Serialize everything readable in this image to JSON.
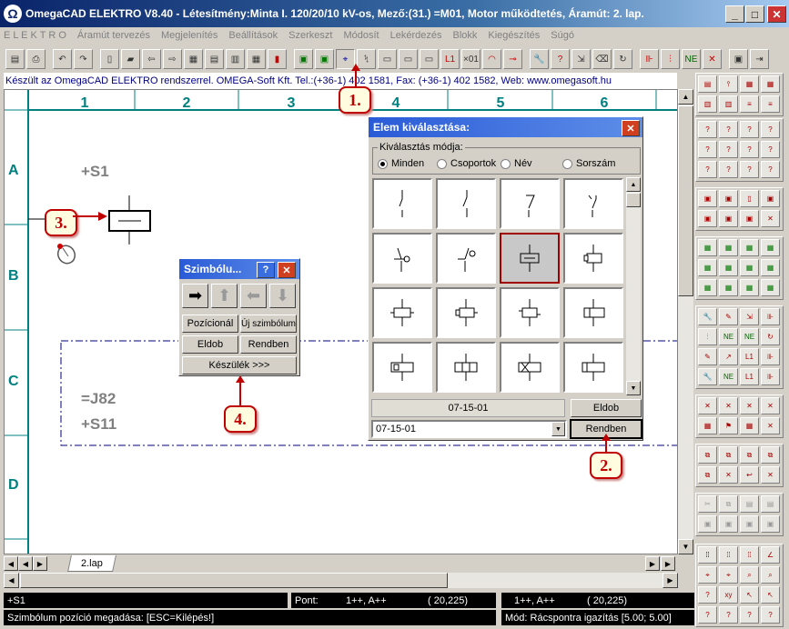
{
  "window": {
    "title": "OmegaCAD ELEKTRO V8.40 - Létesítmény:Minta I. 120/20/10 kV-os, Mező:(31.) =M01, Motor működtetés, Áramút:  2. lap.",
    "logo": "Ω",
    "minimize": "_",
    "maximize": "□",
    "close": "✕"
  },
  "menu": [
    "E L E K T R O",
    "Áramút tervezés",
    "Megjelenítés",
    "Beállítások",
    "Szerkeszt",
    "Módosít",
    "Lekérdezés",
    "Blokk",
    "Kiegészítés",
    "Súgó"
  ],
  "infobar": "Készült az OmegaCAD ELEKTRO rendszerrel. OMEGA-Soft Kft. Tel.:(+36-1) 402 1581, Fax: (+36-1) 402 1582, Web: www.omegasoft.hu",
  "grid": {
    "columns": [
      "1",
      "2",
      "3",
      "4",
      "5",
      "6"
    ],
    "rows": [
      "A",
      "B",
      "C",
      "D"
    ]
  },
  "drawing": {
    "s1_label": "+S1",
    "j82_label": "=J82",
    "s11_label": "+S11"
  },
  "callouts": {
    "c1": "1.",
    "c2": "2.",
    "c3": "3.",
    "c4": "4."
  },
  "symbol_dialog": {
    "title": "Szimbólu...",
    "help": "?",
    "close": "✕",
    "arrows": [
      "➡",
      "⬆",
      "⬅",
      "⬇"
    ],
    "position_btn": "Pozícionál",
    "new_symbol_btn": "Új szimbólum",
    "discard_btn": "Eldob",
    "ok_btn": "Rendben",
    "device_btn": "Készülék >>>"
  },
  "elem_dialog": {
    "title": "Elem kiválasztása:",
    "close": "✕",
    "mode_group": "Kiválasztás módja:",
    "modes": [
      "Minden",
      "Csoportok",
      "Név",
      "Sorszám"
    ],
    "selected_mode": "Minden",
    "selected_code": "07-15-01",
    "combo_value": "07-15-01",
    "discard_btn": "Eldob",
    "ok_btn": "Rendben"
  },
  "tabs": {
    "sheet": "2.lap"
  },
  "status": {
    "left_value": "+S1",
    "point_label": "Pont:",
    "point_value": "1++,  A++",
    "point_coord": "( 20,225)",
    "right_value": "1++,  A++",
    "right_coord": "( 20,225)",
    "hint": "Szimbólum pozíció megadása: [ESC=Kilépés!]",
    "mode": "Mód: Rácspontra igazítás  [5.00; 5.00]"
  }
}
